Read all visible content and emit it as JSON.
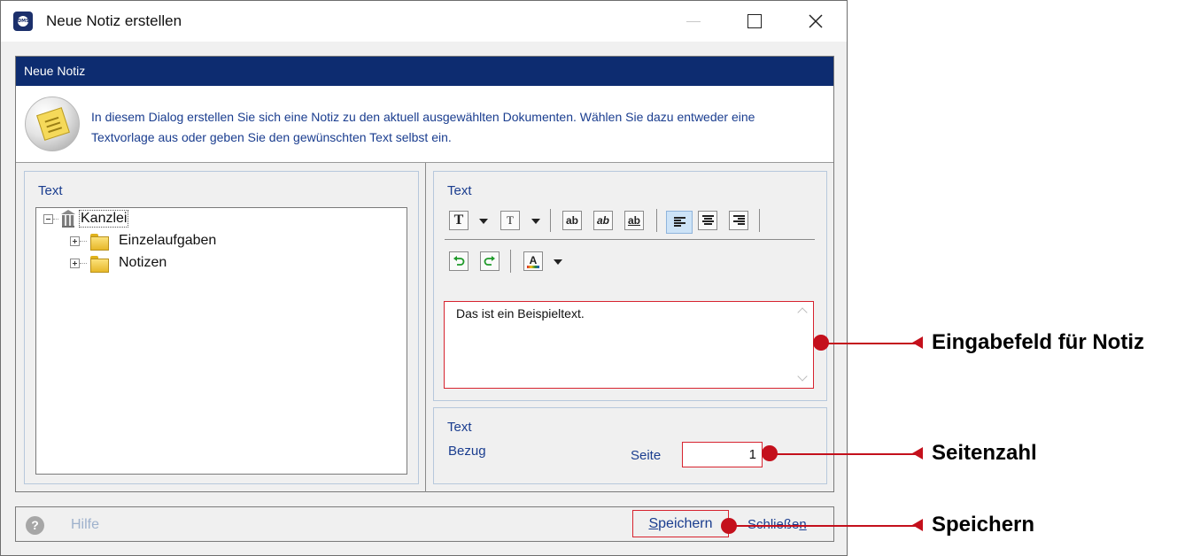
{
  "window": {
    "title": "Neue Notiz erstellen",
    "app_icon_text": "DMS"
  },
  "dialog": {
    "header": "Neue Notiz",
    "info_text": "In diesem Dialog erstellen Sie sich eine Notiz zu den aktuell ausgewählten Dokumenten. Wählen Sie dazu entweder eine Textvorlage aus oder geben Sie den gewünschten Text selbst ein."
  },
  "tree_panel": {
    "caption": "Text",
    "root": "Kanzlei",
    "children": [
      "Einzelaufgaben",
      "Notizen"
    ]
  },
  "editor_panel": {
    "caption": "Text",
    "toolbar": {
      "font_icon": "T",
      "font_size_icon": "T",
      "bold": "ab",
      "italic": "ab",
      "underline": "ab",
      "text_color_icon": "A"
    },
    "note_text": "Das ist ein Beispieltext."
  },
  "reference_panel": {
    "caption": "Text",
    "bezug_label": "Bezug",
    "seite_label": "Seite",
    "page_value": "1"
  },
  "footer": {
    "help_label": "Hilfe",
    "help_icon_glyph": "?",
    "save_label_first": "S",
    "save_label_rest": "peichern",
    "close_label_rest": "Schließe",
    "close_label_last": "n"
  },
  "annotations": {
    "input_field": "Eingabefeld für Notiz",
    "page_number": "Seitenzahl",
    "save": "Speichern"
  },
  "colors": {
    "header_bar": "#0d2c70",
    "label_blue": "#1a3d8f",
    "callout_red": "#c4101c"
  }
}
